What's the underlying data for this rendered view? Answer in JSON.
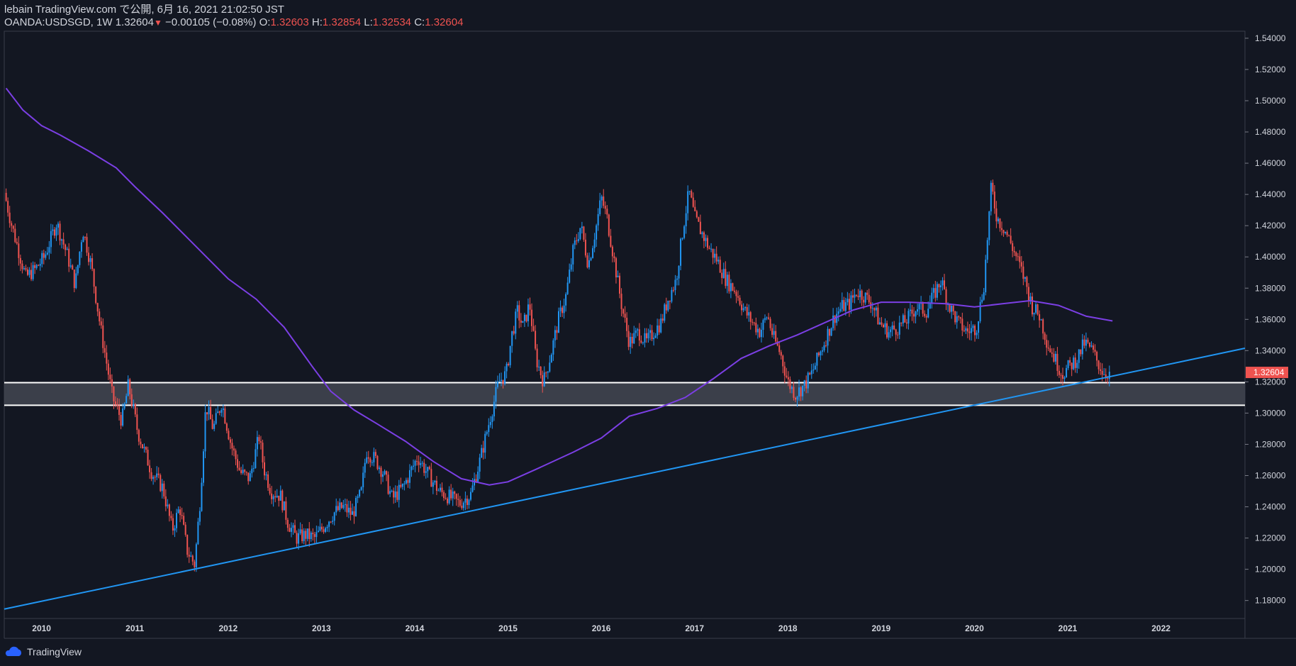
{
  "header": {
    "published": "lebain TradingView.com で公開, 6月 16, 2021 21:02:50 JST",
    "symbol": "OANDA:USDSGD, 1W",
    "last": "1.32604",
    "change": "−0.00105 (−0.08%)",
    "open_label": "O:",
    "open": "1.32603",
    "high_label": "H:",
    "high": "1.32854",
    "low_label": "L:",
    "low": "1.32534",
    "close_label": "C:",
    "close": "1.32604"
  },
  "footer": {
    "brand": "TradingView"
  },
  "colors": {
    "background": "#131722",
    "up": "#2196f3",
    "down": "#ef5350",
    "moving_average": "#7b3fe4",
    "trendline": "#2196f3",
    "zone": "#434651",
    "zone_border": "#ffffff",
    "price_tag": "#ef5350"
  },
  "chart_data": {
    "type": "candlestick",
    "symbol": "OANDA:USDSGD",
    "interval": "1W",
    "x_ticks": [
      "2010",
      "2011",
      "2012",
      "2013",
      "2014",
      "2015",
      "2016",
      "2017",
      "2018",
      "2019",
      "2020",
      "2021",
      "2022"
    ],
    "y_ticks": [
      "1.54000",
      "1.52000",
      "1.50000",
      "1.48000",
      "1.46000",
      "1.44000",
      "1.42000",
      "1.40000",
      "1.38000",
      "1.36000",
      "1.34000",
      "1.32000",
      "1.30000",
      "1.28000",
      "1.26000",
      "1.24000",
      "1.22000",
      "1.20000",
      "1.18000"
    ],
    "x_range": [
      2009.6,
      2022.9
    ],
    "y_range": [
      1.1685,
      1.5445
    ],
    "last_price": "1.32604",
    "price_path": [
      [
        2009.62,
        1.441
      ],
      [
        2009.7,
        1.42
      ],
      [
        2009.85,
        1.387
      ],
      [
        2009.95,
        1.392
      ],
      [
        2010.05,
        1.4
      ],
      [
        2010.18,
        1.422
      ],
      [
        2010.3,
        1.4
      ],
      [
        2010.38,
        1.382
      ],
      [
        2010.46,
        1.418
      ],
      [
        2010.55,
        1.395
      ],
      [
        2010.65,
        1.355
      ],
      [
        2010.78,
        1.31
      ],
      [
        2010.88,
        1.295
      ],
      [
        2010.95,
        1.318
      ],
      [
        2011.05,
        1.288
      ],
      [
        2011.2,
        1.262
      ],
      [
        2011.32,
        1.252
      ],
      [
        2011.42,
        1.225
      ],
      [
        2011.5,
        1.24
      ],
      [
        2011.58,
        1.212
      ],
      [
        2011.66,
        1.203
      ],
      [
        2011.72,
        1.245
      ],
      [
        2011.78,
        1.305
      ],
      [
        2011.86,
        1.29
      ],
      [
        2011.95,
        1.307
      ],
      [
        2012.05,
        1.28
      ],
      [
        2012.15,
        1.262
      ],
      [
        2012.25,
        1.258
      ],
      [
        2012.35,
        1.285
      ],
      [
        2012.4,
        1.265
      ],
      [
        2012.48,
        1.25
      ],
      [
        2012.58,
        1.247
      ],
      [
        2012.66,
        1.23
      ],
      [
        2012.75,
        1.22
      ],
      [
        2012.85,
        1.222
      ],
      [
        2012.95,
        1.22
      ],
      [
        2013.05,
        1.228
      ],
      [
        2013.15,
        1.236
      ],
      [
        2013.25,
        1.24
      ],
      [
        2013.35,
        1.235
      ],
      [
        2013.45,
        1.25
      ],
      [
        2013.5,
        1.276
      ],
      [
        2013.6,
        1.27
      ],
      [
        2013.68,
        1.262
      ],
      [
        2013.78,
        1.245
      ],
      [
        2013.9,
        1.253
      ],
      [
        2014.05,
        1.272
      ],
      [
        2014.15,
        1.262
      ],
      [
        2014.28,
        1.25
      ],
      [
        2014.4,
        1.246
      ],
      [
        2014.5,
        1.242
      ],
      [
        2014.62,
        1.248
      ],
      [
        2014.72,
        1.27
      ],
      [
        2014.82,
        1.295
      ],
      [
        2014.92,
        1.32
      ],
      [
        2015.0,
        1.325
      ],
      [
        2015.06,
        1.35
      ],
      [
        2015.12,
        1.365
      ],
      [
        2015.18,
        1.355
      ],
      [
        2015.25,
        1.37
      ],
      [
        2015.32,
        1.335
      ],
      [
        2015.4,
        1.32
      ],
      [
        2015.48,
        1.338
      ],
      [
        2015.56,
        1.36
      ],
      [
        2015.64,
        1.375
      ],
      [
        2015.72,
        1.405
      ],
      [
        2015.8,
        1.42
      ],
      [
        2015.88,
        1.395
      ],
      [
        2015.96,
        1.418
      ],
      [
        2016.02,
        1.438
      ],
      [
        2016.08,
        1.425
      ],
      [
        2016.16,
        1.397
      ],
      [
        2016.24,
        1.368
      ],
      [
        2016.32,
        1.345
      ],
      [
        2016.42,
        1.352
      ],
      [
        2016.5,
        1.345
      ],
      [
        2016.58,
        1.352
      ],
      [
        2016.66,
        1.358
      ],
      [
        2016.74,
        1.374
      ],
      [
        2016.82,
        1.385
      ],
      [
        2016.9,
        1.42
      ],
      [
        2016.96,
        1.442
      ],
      [
        2017.02,
        1.425
      ],
      [
        2017.1,
        1.415
      ],
      [
        2017.18,
        1.405
      ],
      [
        2017.26,
        1.398
      ],
      [
        2017.36,
        1.385
      ],
      [
        2017.46,
        1.378
      ],
      [
        2017.56,
        1.365
      ],
      [
        2017.64,
        1.358
      ],
      [
        2017.72,
        1.352
      ],
      [
        2017.8,
        1.363
      ],
      [
        2017.86,
        1.349
      ],
      [
        2017.94,
        1.338
      ],
      [
        2018.02,
        1.32
      ],
      [
        2018.1,
        1.312
      ],
      [
        2018.2,
        1.318
      ],
      [
        2018.28,
        1.326
      ],
      [
        2018.36,
        1.338
      ],
      [
        2018.44,
        1.35
      ],
      [
        2018.52,
        1.362
      ],
      [
        2018.6,
        1.368
      ],
      [
        2018.68,
        1.37
      ],
      [
        2018.76,
        1.378
      ],
      [
        2018.84,
        1.375
      ],
      [
        2018.92,
        1.37
      ],
      [
        2019.0,
        1.358
      ],
      [
        2019.1,
        1.352
      ],
      [
        2019.2,
        1.355
      ],
      [
        2019.3,
        1.36
      ],
      [
        2019.4,
        1.368
      ],
      [
        2019.5,
        1.365
      ],
      [
        2019.58,
        1.375
      ],
      [
        2019.66,
        1.385
      ],
      [
        2019.74,
        1.37
      ],
      [
        2019.84,
        1.358
      ],
      [
        2019.94,
        1.352
      ],
      [
        2020.04,
        1.355
      ],
      [
        2020.12,
        1.382
      ],
      [
        2020.2,
        1.445
      ],
      [
        2020.26,
        1.425
      ],
      [
        2020.34,
        1.418
      ],
      [
        2020.4,
        1.41
      ],
      [
        2020.48,
        1.398
      ],
      [
        2020.56,
        1.385
      ],
      [
        2020.64,
        1.368
      ],
      [
        2020.72,
        1.362
      ],
      [
        2020.8,
        1.345
      ],
      [
        2020.88,
        1.335
      ],
      [
        2020.96,
        1.325
      ],
      [
        2021.04,
        1.33
      ],
      [
        2021.12,
        1.335
      ],
      [
        2021.2,
        1.345
      ],
      [
        2021.28,
        1.34
      ],
      [
        2021.36,
        1.33
      ],
      [
        2021.42,
        1.325
      ],
      [
        2021.46,
        1.326
      ]
    ],
    "moving_average": [
      [
        2009.62,
        1.508
      ],
      [
        2009.8,
        1.494
      ],
      [
        2010.0,
        1.484
      ],
      [
        2010.2,
        1.478
      ],
      [
        2010.5,
        1.468
      ],
      [
        2010.8,
        1.457
      ],
      [
        2011.0,
        1.445
      ],
      [
        2011.3,
        1.428
      ],
      [
        2011.6,
        1.41
      ],
      [
        2012.0,
        1.386
      ],
      [
        2012.3,
        1.373
      ],
      [
        2012.6,
        1.355
      ],
      [
        2012.9,
        1.33
      ],
      [
        2013.1,
        1.314
      ],
      [
        2013.35,
        1.302
      ],
      [
        2013.6,
        1.293
      ],
      [
        2013.9,
        1.282
      ],
      [
        2014.2,
        1.269
      ],
      [
        2014.5,
        1.258
      ],
      [
        2014.8,
        1.254
      ],
      [
        2015.0,
        1.256
      ],
      [
        2015.3,
        1.264
      ],
      [
        2015.7,
        1.275
      ],
      [
        2016.0,
        1.284
      ],
      [
        2016.3,
        1.298
      ],
      [
        2016.6,
        1.303
      ],
      [
        2016.9,
        1.31
      ],
      [
        2017.2,
        1.322
      ],
      [
        2017.5,
        1.335
      ],
      [
        2017.8,
        1.343
      ],
      [
        2018.1,
        1.35
      ],
      [
        2018.4,
        1.358
      ],
      [
        2018.7,
        1.366
      ],
      [
        2019.0,
        1.371
      ],
      [
        2019.3,
        1.371
      ],
      [
        2019.7,
        1.37
      ],
      [
        2020.0,
        1.368
      ],
      [
        2020.3,
        1.37
      ],
      [
        2020.6,
        1.372
      ],
      [
        2020.9,
        1.369
      ],
      [
        2021.2,
        1.362
      ],
      [
        2021.48,
        1.359
      ]
    ],
    "trendline": {
      "from": [
        2009.6,
        1.1745
      ],
      "to": [
        2022.9,
        1.3415
      ]
    },
    "support_zone": {
      "top": 1.3195,
      "bottom": 1.305
    }
  }
}
